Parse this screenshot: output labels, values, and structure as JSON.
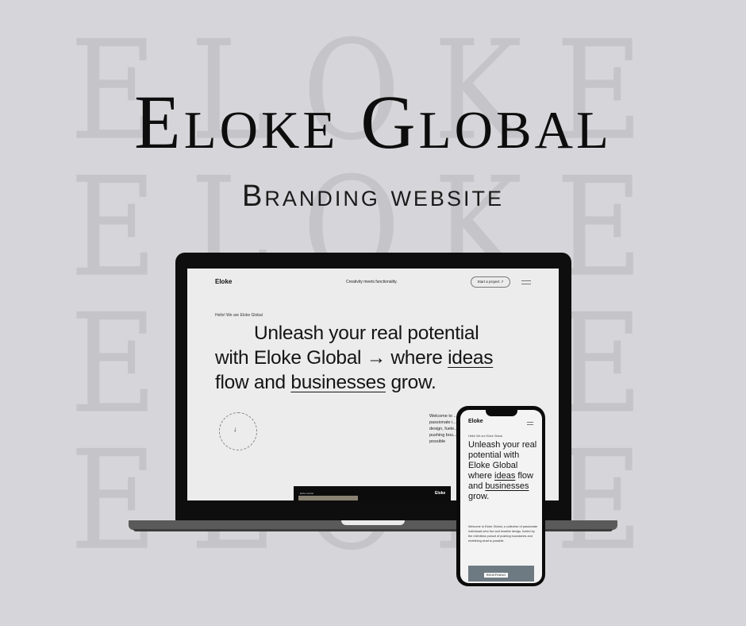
{
  "background": {
    "watermark_words": [
      "ELOKE",
      "ELOKE",
      "ELOKE",
      "ELOKE"
    ],
    "color": "#d6d6da",
    "watermark_color": "#c4c4c9"
  },
  "header": {
    "title": "Eloke Global",
    "subtitle": "Branding website"
  },
  "laptop_site": {
    "logo": "Eloke",
    "tagline": "Creativity meets functionality.",
    "cta": "Start a project ↗",
    "greeting": "Hello! We are Eloke Global",
    "headline_parts": [
      "Unleash your real potential",
      "with Eloke Global → where ",
      "ideas",
      "flow and ",
      "businesses",
      " grow."
    ],
    "scroll_arrow": "↓",
    "welcome_snippet": "Welcome to ... passionate i... design, fuele... pushing bou... possible",
    "banner_logo": "Eloke",
    "banner_text": "Eloke Global"
  },
  "phone_site": {
    "logo": "Eloke",
    "greeting": "Hello! We are Eloke Global",
    "headline_parts": [
      "Unleash your real potential with Eloke Global where ",
      "ideas",
      " flow and ",
      "businesses",
      " grow."
    ],
    "body": "Welcome to Eloke Global, a collective of passionate individuals who live and breathe design, fueled by the relentless pursuit of pushing boundaries and redefining what is possible.",
    "image_label": "REDEFINING"
  }
}
